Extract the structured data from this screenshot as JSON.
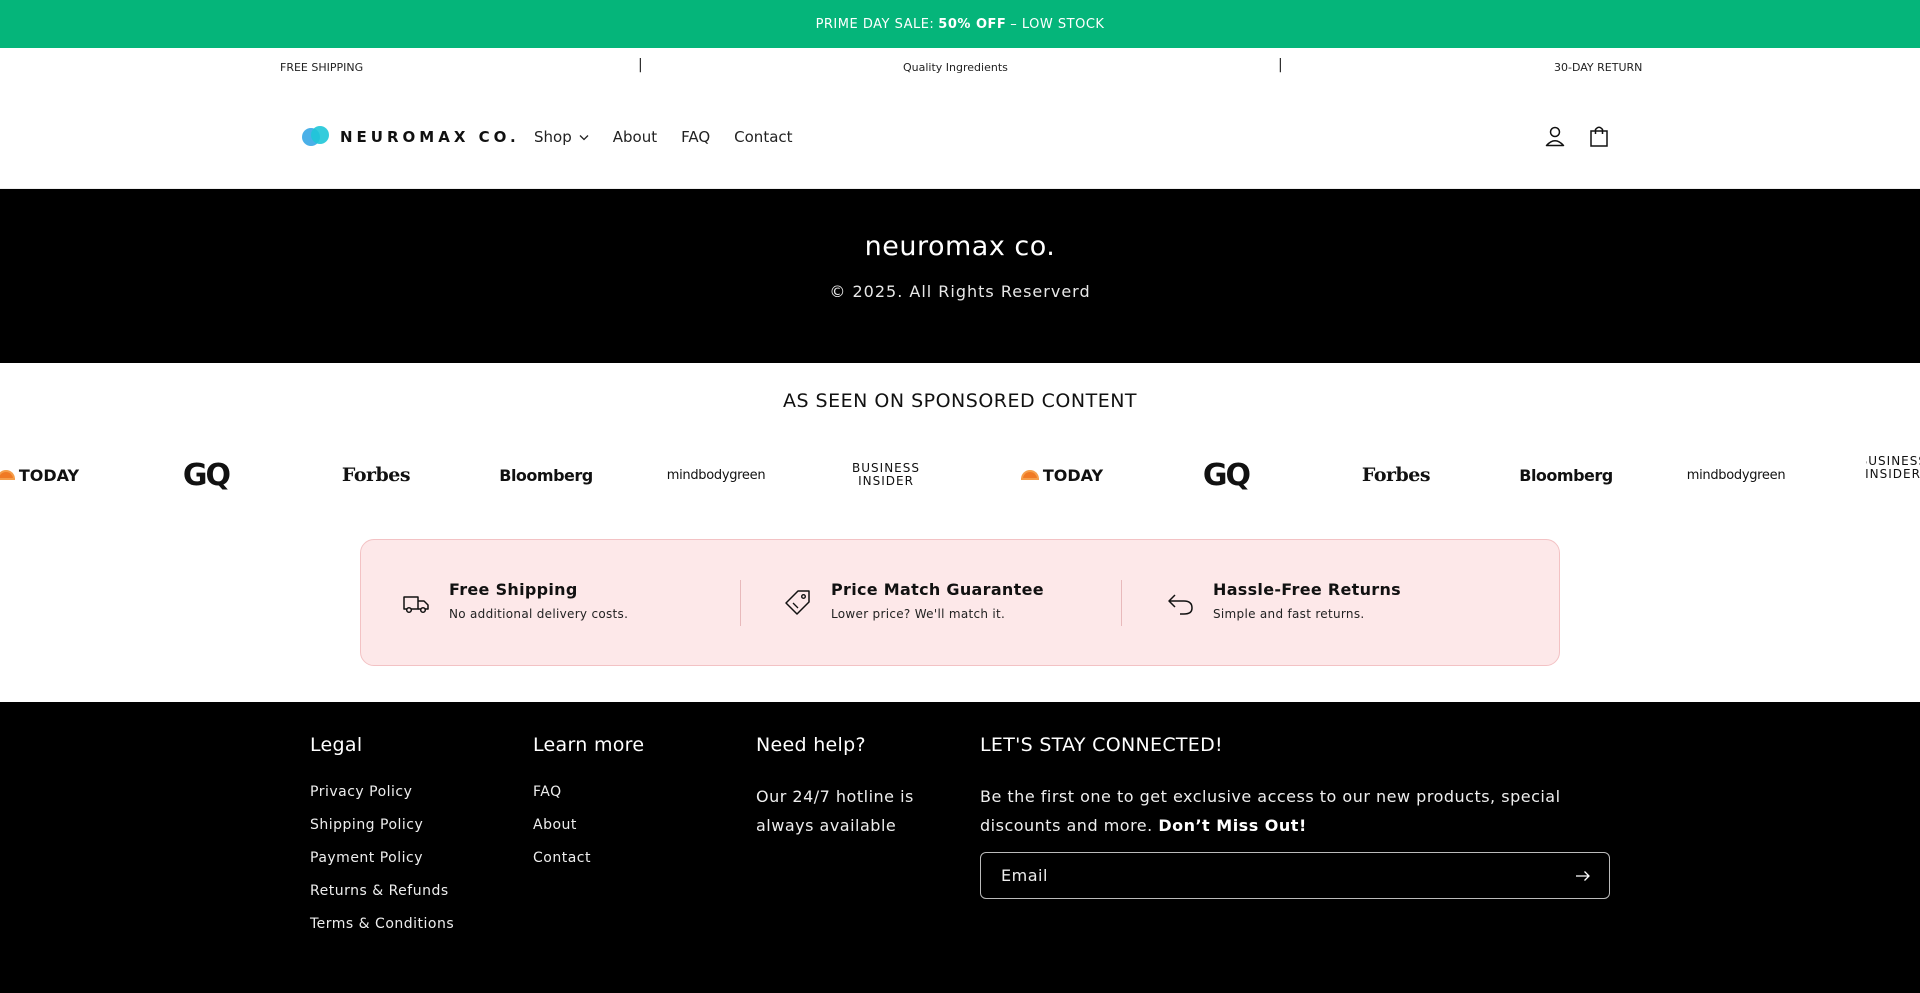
{
  "announcement": {
    "prefix": "PRIME DAY SALE:",
    "highlight": "50% OFF",
    "suffix": "– LOW STOCK"
  },
  "perks": {
    "items": [
      "FREE SHIPPING",
      "Quality Ingredients",
      "30-DAY RETURN"
    ],
    "separator": "|"
  },
  "header": {
    "logo_text": "NEUROMAX CO.",
    "nav": [
      {
        "label": "Shop",
        "has_dropdown": true
      },
      {
        "label": "About"
      },
      {
        "label": "FAQ"
      },
      {
        "label": "Contact"
      }
    ],
    "icons": [
      "account-icon",
      "cart-icon"
    ]
  },
  "banner": {
    "title": "neuromax co.",
    "copyright": "© 2025. All Rights Reserverd"
  },
  "press": {
    "title": "AS SEEN ON SPONSORED CONTENT",
    "logos": [
      {
        "label": "TODAY",
        "style": "today"
      },
      {
        "label": "GQ",
        "style": "gq"
      },
      {
        "label": "Forbes",
        "style": "forbes"
      },
      {
        "label": "Bloomberg",
        "style": "bloomberg"
      },
      {
        "label": "mindbodygreen",
        "style": "mbg"
      },
      {
        "label": "BUSINESS INSIDER",
        "style": "bi"
      },
      {
        "label": "TODAY",
        "style": "today"
      },
      {
        "label": "GQ",
        "style": "gq"
      },
      {
        "label": "Forbes",
        "style": "forbes"
      },
      {
        "label": "Bloomberg",
        "style": "bloomberg"
      },
      {
        "label": "mindbodygreen",
        "style": "mbg"
      },
      {
        "label": "BUSINESS INSIDER",
        "style": "bi"
      }
    ]
  },
  "guarantees": [
    {
      "icon": "truck-icon",
      "title": "Free Shipping",
      "subtitle": "No additional delivery costs."
    },
    {
      "icon": "price-tag-icon",
      "title": "Price Match Guarantee",
      "subtitle": "Lower price? We'll match it."
    },
    {
      "icon": "return-arrow-icon",
      "title": "Hassle-Free Returns",
      "subtitle": "Simple and fast returns."
    }
  ],
  "footer": {
    "legal": {
      "heading": "Legal",
      "links": [
        "Privacy Policy",
        "Shipping Policy",
        "Payment Policy",
        "Returns & Refunds",
        "Terms & Conditions"
      ]
    },
    "learn": {
      "heading": "Learn more",
      "links": [
        "FAQ",
        "About",
        "Contact"
      ]
    },
    "help": {
      "heading": "Need help?",
      "text": "Our 24/7 hotline is always available"
    },
    "newsletter": {
      "heading": "LET'S STAY CONNECTED!",
      "text": "Be the first one to get exclusive access to our new products, special discounts and more.",
      "emphasis": "Don’t Miss Out!",
      "email_placeholder": "Email"
    }
  }
}
